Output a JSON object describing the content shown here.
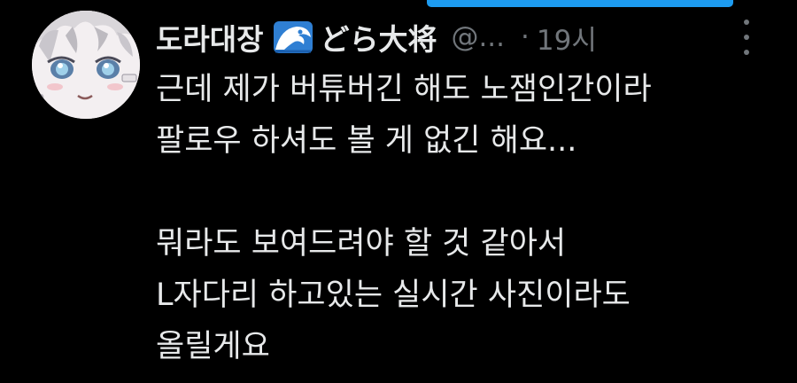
{
  "tweet": {
    "author": {
      "display_name": "도라대장",
      "display_name_emoji_icon": "water-wave-icon",
      "display_name_jp": "どら大将",
      "handle": "@...",
      "avatar_icon": "avatar"
    },
    "separator": "·",
    "time": "19시",
    "more_icon": "more-vertical-icon",
    "body": {
      "paragraph1": {
        "line1": "근데 제가 버튜버긴 해도 노잼인간이라",
        "line2": "팔로우 하셔도 볼 게 없긴 해요..."
      },
      "paragraph2": {
        "line1": "뭐라도 보여드려야 할 것 같아서",
        "line2": "L자다리 하고있는 실시간 사진이라도",
        "line3": "올릴게요"
      }
    }
  },
  "colors": {
    "background": "#000000",
    "text_primary": "#e7e9ea",
    "text_secondary": "#71767b",
    "accent": "#1d9bf0"
  }
}
